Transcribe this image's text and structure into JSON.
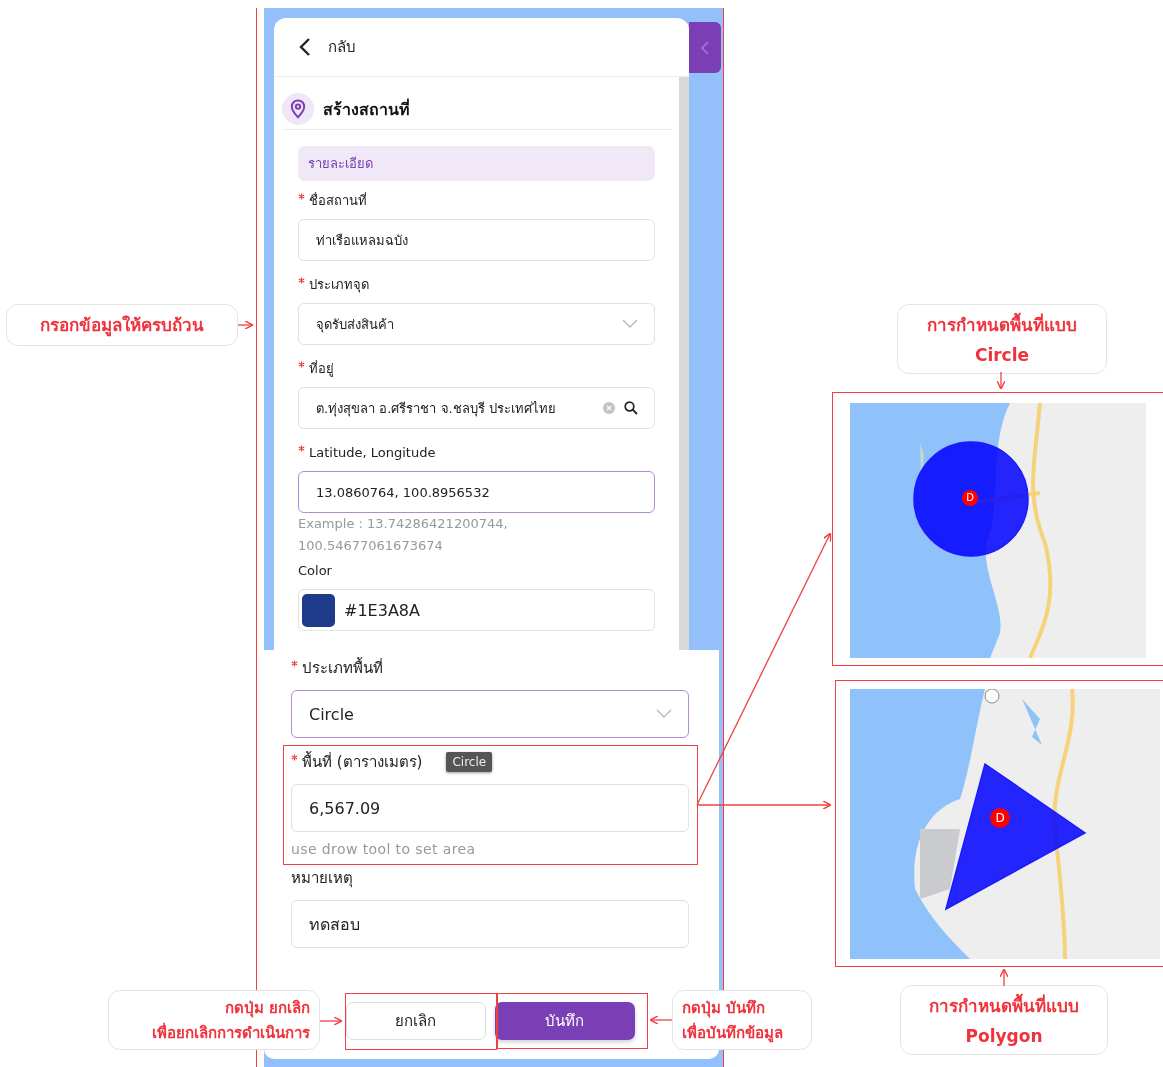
{
  "form": {
    "back_label": "กลับ",
    "title": "สร้างสถานที่",
    "section": "รายละเอียด",
    "card_fields": [
      {
        "kind": "text",
        "label": "ชื่อสถานที่",
        "required": true,
        "value": "ท่าเรือแหลมฉบัง",
        "focused": false
      },
      {
        "kind": "select",
        "label": "ประเภทจุด",
        "required": true,
        "value": "จุดรับส่งสินค้า",
        "focused": false
      },
      {
        "kind": "search",
        "label": "ที่อยู่",
        "required": true,
        "value": "ต.ทุ่งสุขลา อ.ศรีราชา จ.ชลบุรี ประเทศไทย",
        "focused": false
      },
      {
        "kind": "text",
        "label": "Latitude, Longitude",
        "required": true,
        "value": "13.0860764, 100.8956532",
        "focused": true,
        "hint": "Example : 13.74286421200744, 100.54677061673674"
      },
      {
        "kind": "color",
        "label": "Color",
        "required": false,
        "value": "#1E3A8A",
        "color": "#1e3a8a"
      }
    ],
    "sheet_fields": [
      {
        "kind": "select",
        "label": "ประเภทพื้นที่",
        "required": true,
        "value": "Circle",
        "focused": true
      },
      {
        "kind": "text",
        "label": "พื้นที่ (ตารางเมตร)",
        "required": true,
        "value": "6,567.09",
        "focused": false,
        "tooltip": "Circle",
        "hint": "use drow tool to set area"
      },
      {
        "kind": "text",
        "label": "หมายเหตุ",
        "required": false,
        "value": "ทดสอบ",
        "focused": false
      }
    ],
    "buttons": [
      {
        "kind": "secondary",
        "label": "ยกเลิก"
      },
      {
        "kind": "primary",
        "label": "บันทึก"
      }
    ]
  },
  "annotations": [
    {
      "kind": "fill",
      "text": "กรอกข้อมูลให้ครบถ้วน"
    },
    {
      "kind": "circle",
      "text": "การกำหนดพื้นที่แบบ\nCircle"
    },
    {
      "kind": "cancel",
      "text": "กดปุ่ม ยกเลิก\nเพื่อยกเลิกการดำเนินการ"
    },
    {
      "kind": "save",
      "text": "กดปุ่ม บันทึก\nเพื่อบันทึกข้อมูล"
    },
    {
      "kind": "polygon",
      "text": "การกำหนดพื้นที่แบบ\nPolygon"
    }
  ],
  "maps": [
    {
      "kind": "circle",
      "marker": "D"
    },
    {
      "kind": "polygon",
      "marker": "D"
    }
  ]
}
